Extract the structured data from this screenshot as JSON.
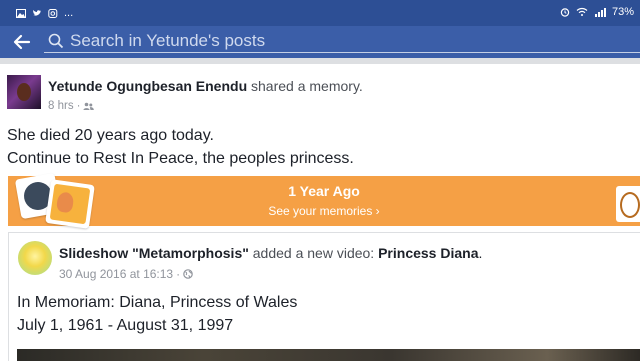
{
  "status_bar": {
    "left_icons": [
      "gallery-icon",
      "twitter-icon",
      "instagram-icon"
    ],
    "overflow": "...",
    "right_icons": [
      "alarm-icon",
      "wifi-icon",
      "signal-icon"
    ],
    "battery": "73%"
  },
  "search": {
    "placeholder": "Search in Yetunde's posts"
  },
  "post": {
    "author": "Yetunde Ogungbesan Enendu",
    "action": "shared a memory.",
    "time": "8 hrs",
    "audience_icon": "friends-icon",
    "body_lines": [
      "She died 20 years ago today.",
      "Continue to Rest In Peace,  the peoples princess."
    ]
  },
  "memory_banner": {
    "title": "1 Year Ago",
    "link": "See your memories ›",
    "color": "#f5a045"
  },
  "shared_post": {
    "page_name": "Slideshow \"Metamorphosis\"",
    "action": "added a new video:",
    "video_title": "Princess Diana",
    "period": ".",
    "date": "30 Aug 2016 at 16:13",
    "audience_icon": "globe-icon",
    "body_lines": [
      "In Memoriam: Diana, Princess of Wales",
      "July 1, 1961 - August 31, 1997"
    ]
  },
  "colors": {
    "status_bar": "#2d4f95",
    "search_bar": "#3b5ea8",
    "banner": "#f5a045"
  }
}
